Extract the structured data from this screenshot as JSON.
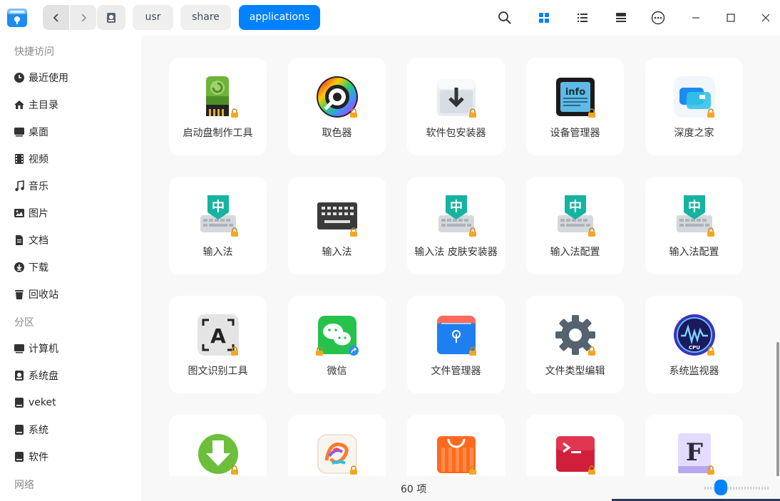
{
  "breadcrumbs": [
    "usr",
    "share",
    "applications"
  ],
  "sidebar": {
    "groups": [
      "快捷访问",
      "分区",
      "网络"
    ],
    "quick": [
      {
        "label": "最近使用",
        "icon": "clock-icon"
      },
      {
        "label": "主目录",
        "icon": "home-icon"
      },
      {
        "label": "桌面",
        "icon": "desktop-icon"
      },
      {
        "label": "视频",
        "icon": "video-icon"
      },
      {
        "label": "音乐",
        "icon": "music-icon"
      },
      {
        "label": "图片",
        "icon": "picture-icon"
      },
      {
        "label": "文档",
        "icon": "document-icon"
      },
      {
        "label": "下载",
        "icon": "download-icon"
      },
      {
        "label": "回收站",
        "icon": "trash-icon"
      }
    ],
    "partitions": [
      {
        "label": "计算机",
        "icon": "computer-icon"
      },
      {
        "label": "系统盘",
        "icon": "system-disk-icon"
      },
      {
        "label": "veket",
        "icon": "drive-icon"
      },
      {
        "label": "系统",
        "icon": "drive-icon"
      },
      {
        "label": "软件",
        "icon": "drive-icon"
      }
    ]
  },
  "apps": [
    {
      "label": "启动盘制作工具",
      "icon": "boot-maker-icon"
    },
    {
      "label": "取色器",
      "icon": "color-picker-icon"
    },
    {
      "label": "软件包安装器",
      "icon": "package-installer-icon"
    },
    {
      "label": "设备管理器",
      "icon": "device-manager-icon"
    },
    {
      "label": "深度之家",
      "icon": "deepin-home-icon"
    },
    {
      "label": "输入法",
      "icon": "input-method-icon"
    },
    {
      "label": "输入法",
      "icon": "keyboard-icon"
    },
    {
      "label": "输入法 皮肤安装器",
      "icon": "input-method-icon"
    },
    {
      "label": "输入法配置",
      "icon": "input-method-icon"
    },
    {
      "label": "输入法配置",
      "icon": "input-method-icon"
    },
    {
      "label": "图文识别工具",
      "icon": "ocr-icon"
    },
    {
      "label": "微信",
      "icon": "wechat-icon"
    },
    {
      "label": "文件管理器",
      "icon": "file-manager-icon"
    },
    {
      "label": "文件类型编辑",
      "icon": "gear-icon"
    },
    {
      "label": "系统监视器",
      "icon": "system-monitor-icon"
    },
    {
      "label": "",
      "icon": "downloader-icon"
    },
    {
      "label": "",
      "icon": "draw-icon"
    },
    {
      "label": "",
      "icon": "app-store-icon"
    },
    {
      "label": "",
      "icon": "terminal-icon"
    },
    {
      "label": "",
      "icon": "font-manager-icon"
    }
  ],
  "status": {
    "count": "60 项"
  },
  "colors": {
    "accent": "#0081ff",
    "lock": "#f5a623"
  }
}
